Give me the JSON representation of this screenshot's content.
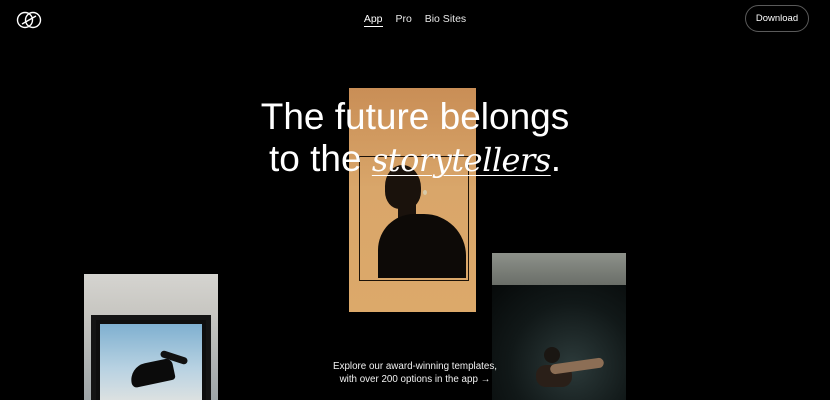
{
  "logo": {
    "icon": "brand-logo-icon"
  },
  "nav": {
    "items": [
      {
        "label": "App",
        "active": true
      },
      {
        "label": "Pro",
        "active": false
      },
      {
        "label": "Bio Sites",
        "active": false
      }
    ]
  },
  "header": {
    "download_label": "Download"
  },
  "hero": {
    "line1": "The future belongs",
    "line2_prefix": "to the ",
    "line2_italic": "storytellers",
    "line2_suffix": "."
  },
  "promo": {
    "line1": "Explore our award-winning templates,",
    "line2": "with over 200 options in the app",
    "arrow": "→"
  },
  "colors": {
    "background": "#000000",
    "text": "#ffffff",
    "accent": "#d9a66a"
  }
}
